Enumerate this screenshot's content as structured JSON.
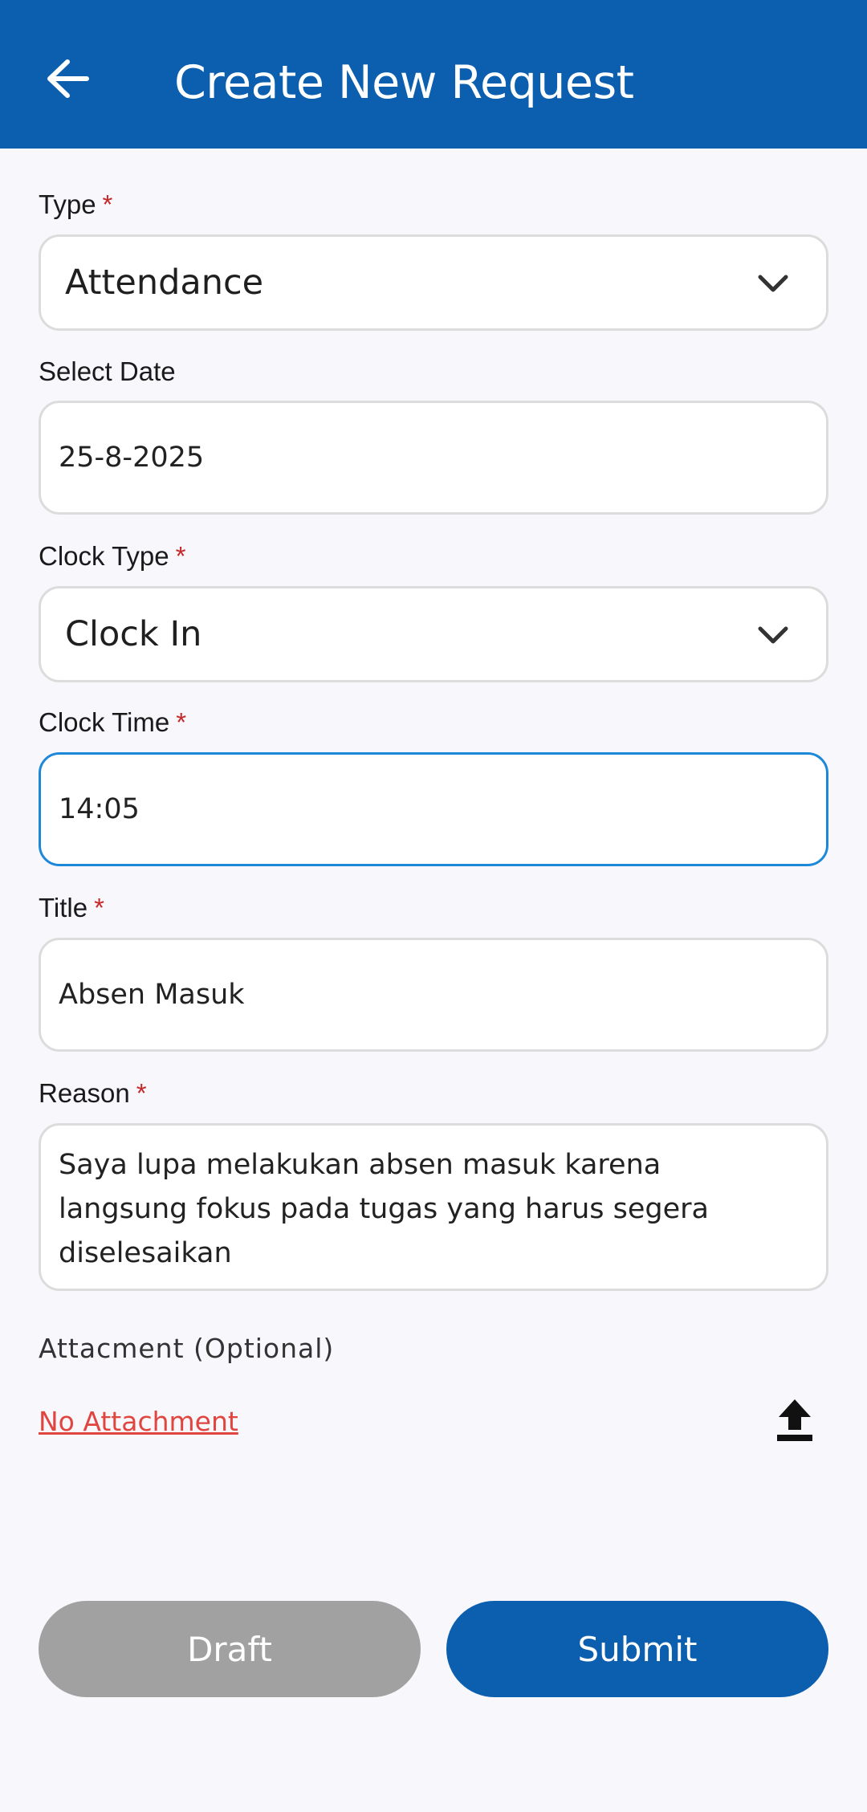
{
  "appbar": {
    "title": "Create New Request",
    "back_icon": "arrow-left-icon"
  },
  "form": {
    "type": {
      "label": "Type",
      "required": "*",
      "value": "Attendance"
    },
    "date": {
      "label": "Select Date",
      "value": "25-8-2025"
    },
    "clock_type": {
      "label": "Clock Type",
      "required": "*",
      "value": "Clock In"
    },
    "clock_time": {
      "label": "Clock Time",
      "required": "*",
      "value": "14:05"
    },
    "title": {
      "label": "Title",
      "required": "*",
      "value": "Absen Masuk"
    },
    "reason": {
      "label": "Reason",
      "required": "*",
      "lines": [
        "Saya lupa melakukan absen masuk karena",
        "langsung fokus pada tugas yang harus segera",
        "diselesaikan"
      ]
    },
    "attachment": {
      "label": "Attacment (Optional)",
      "status": "No Attachment",
      "upload_icon": "upload-icon"
    }
  },
  "actions": {
    "draft_label": "Draft",
    "submit_label": "Submit"
  },
  "colors": {
    "primary": "#0c5faf",
    "required": "#c62828",
    "link": "#e0463f",
    "draft": "#a1a1a1",
    "focus": "#1e88d8"
  }
}
